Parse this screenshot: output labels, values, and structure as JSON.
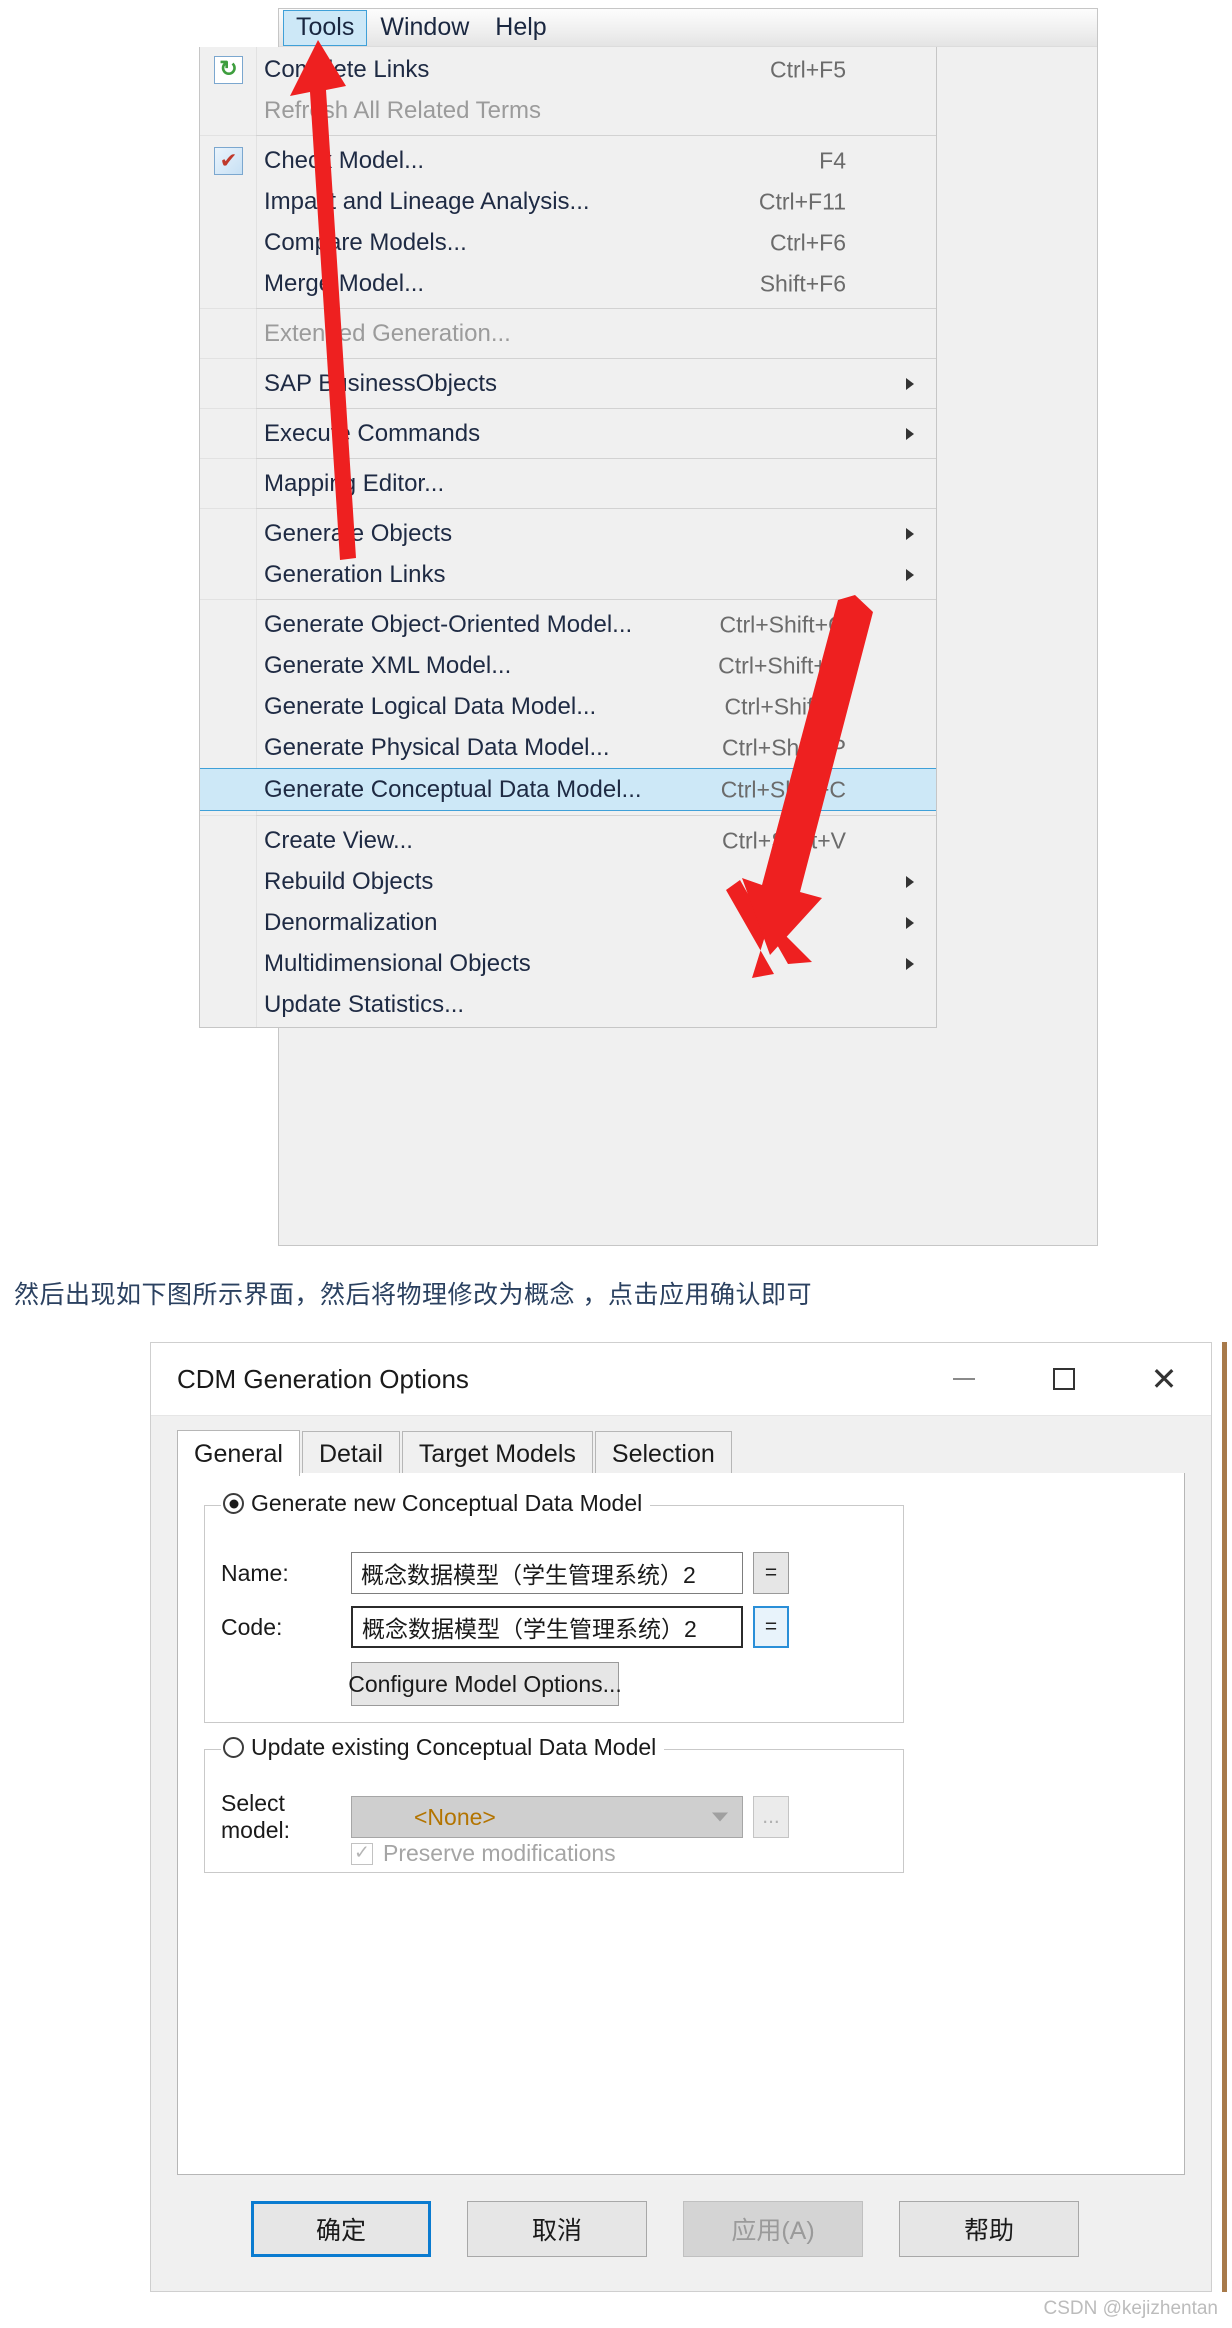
{
  "menu": {
    "bar_items": [
      {
        "label": "Tools",
        "active": true
      },
      {
        "label": "Window",
        "active": false
      },
      {
        "label": "Help",
        "active": false
      }
    ],
    "items": [
      {
        "label": "Complete Links",
        "shortcut": "Ctrl+F5",
        "icon": "complete-links-icon",
        "disabled": false,
        "submenu": false,
        "selected": false
      },
      {
        "label": "Refresh All Related Terms",
        "shortcut": "",
        "icon": "",
        "disabled": true,
        "submenu": false,
        "selected": false
      },
      {
        "separator": true
      },
      {
        "label": "Check Model...",
        "shortcut": "F4",
        "icon": "check-model-icon",
        "disabled": false,
        "submenu": false,
        "selected": false
      },
      {
        "label": "Impact and Lineage Analysis...",
        "shortcut": "Ctrl+F11",
        "icon": "",
        "disabled": false,
        "submenu": false,
        "selected": false
      },
      {
        "label": "Compare Models...",
        "shortcut": "Ctrl+F6",
        "icon": "",
        "disabled": false,
        "submenu": false,
        "selected": false
      },
      {
        "label": "Merge Model...",
        "shortcut": "Shift+F6",
        "icon": "",
        "disabled": false,
        "submenu": false,
        "selected": false
      },
      {
        "separator": true
      },
      {
        "label": "Extended Generation...",
        "shortcut": "",
        "icon": "",
        "disabled": true,
        "submenu": false,
        "selected": false
      },
      {
        "separator": true
      },
      {
        "label": "SAP BusinessObjects",
        "shortcut": "",
        "icon": "",
        "disabled": false,
        "submenu": true,
        "selected": false
      },
      {
        "separator": true
      },
      {
        "label": "Execute Commands",
        "shortcut": "",
        "icon": "",
        "disabled": false,
        "submenu": true,
        "selected": false
      },
      {
        "separator": true
      },
      {
        "label": "Mapping Editor...",
        "shortcut": "",
        "icon": "",
        "disabled": false,
        "submenu": false,
        "selected": false
      },
      {
        "separator": true
      },
      {
        "label": "Generate Objects",
        "shortcut": "",
        "icon": "",
        "disabled": false,
        "submenu": true,
        "selected": false
      },
      {
        "label": "Generation Links",
        "shortcut": "",
        "icon": "",
        "disabled": false,
        "submenu": true,
        "selected": false
      },
      {
        "separator": true
      },
      {
        "label": "Generate Object-Oriented Model...",
        "shortcut": "Ctrl+Shift+O",
        "icon": "",
        "disabled": false,
        "submenu": false,
        "selected": false
      },
      {
        "label": "Generate XML Model...",
        "shortcut": "Ctrl+Shift+M",
        "icon": "",
        "disabled": false,
        "submenu": false,
        "selected": false
      },
      {
        "label": "Generate Logical Data Model...",
        "shortcut": "Ctrl+Shift+L",
        "icon": "",
        "disabled": false,
        "submenu": false,
        "selected": false
      },
      {
        "label": "Generate Physical Data Model...",
        "shortcut": "Ctrl+Shift+P",
        "icon": "",
        "disabled": false,
        "submenu": false,
        "selected": false
      },
      {
        "label": "Generate Conceptual Data Model...",
        "shortcut": "Ctrl+Shift+C",
        "icon": "",
        "disabled": false,
        "submenu": false,
        "selected": true
      },
      {
        "separator": true
      },
      {
        "label": "Create View...",
        "shortcut": "Ctrl+Shift+V",
        "icon": "",
        "disabled": false,
        "submenu": false,
        "selected": false
      },
      {
        "label": "Rebuild Objects",
        "shortcut": "",
        "icon": "",
        "disabled": false,
        "submenu": true,
        "selected": false
      },
      {
        "label": "Denormalization",
        "shortcut": "",
        "icon": "",
        "disabled": false,
        "submenu": true,
        "selected": false
      },
      {
        "label": "Multidimensional Objects",
        "shortcut": "",
        "icon": "",
        "disabled": false,
        "submenu": true,
        "selected": false
      },
      {
        "label": "Update Statistics...",
        "shortcut": "",
        "icon": "",
        "disabled": false,
        "submenu": false,
        "selected": false
      }
    ]
  },
  "caption": "然后出现如下图所示界面，然后将物理修改为概念 ，点击应用确认即可",
  "dialog": {
    "title": "CDM Generation Options",
    "window_controls": {
      "minimize": "minimize-icon",
      "maximize": "maximize-icon",
      "close": "✕"
    },
    "tabs": [
      {
        "label": "General",
        "active": true
      },
      {
        "label": "Detail",
        "active": false
      },
      {
        "label": "Target Models",
        "active": false
      },
      {
        "label": "Selection",
        "active": false
      }
    ],
    "generate_group": {
      "legend": "Generate new Conceptual Data Model",
      "radio_selected": true,
      "name_label": "Name:",
      "name_value": "概念数据模型（学生管理系统）2",
      "name_button": "=",
      "code_label": "Code:",
      "code_value": "概念数据模型（学生管理系统）2",
      "code_button": "=",
      "configure_button": "Configure Model Options..."
    },
    "update_group": {
      "legend": "Update existing Conceptual Data Model",
      "radio_selected": false,
      "select_label": "Select model:",
      "select_value": "<None>",
      "browse_button": "...",
      "preserve_label": "Preserve modifications",
      "preserve_checked": true
    },
    "buttons": [
      {
        "label": "确定",
        "style": "default"
      },
      {
        "label": "取消",
        "style": "normal"
      },
      {
        "label": "应用(A)",
        "style": "disabled"
      },
      {
        "label": "帮助",
        "style": "normal"
      }
    ]
  },
  "watermark": "CSDN @kejizhentan",
  "colors": {
    "accent_blue": "#0a7bd0",
    "selection_bg": "#cde8f7",
    "selection_border": "#3fa0d8",
    "arrow_red": "#ee2020",
    "caption_text": "#2b4160",
    "menu_bg": "#f0f0f0"
  }
}
